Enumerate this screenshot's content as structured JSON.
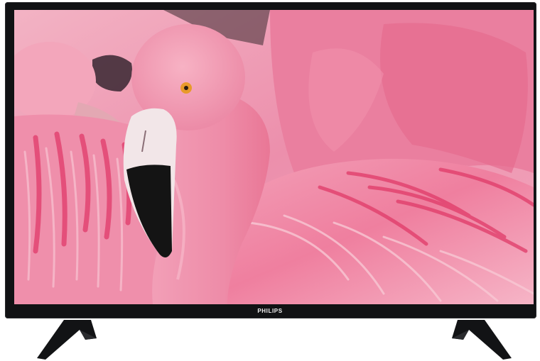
{
  "product": {
    "brand_label": "PHILIPS"
  },
  "screen_content": {
    "subject_icon": "flamingo-image"
  },
  "colors": {
    "bezel": "#111214",
    "feather_pink": "#f07aa0",
    "feather_light": "#f6a9bf",
    "beak_black": "#141414",
    "eye": "#e89a2a"
  }
}
